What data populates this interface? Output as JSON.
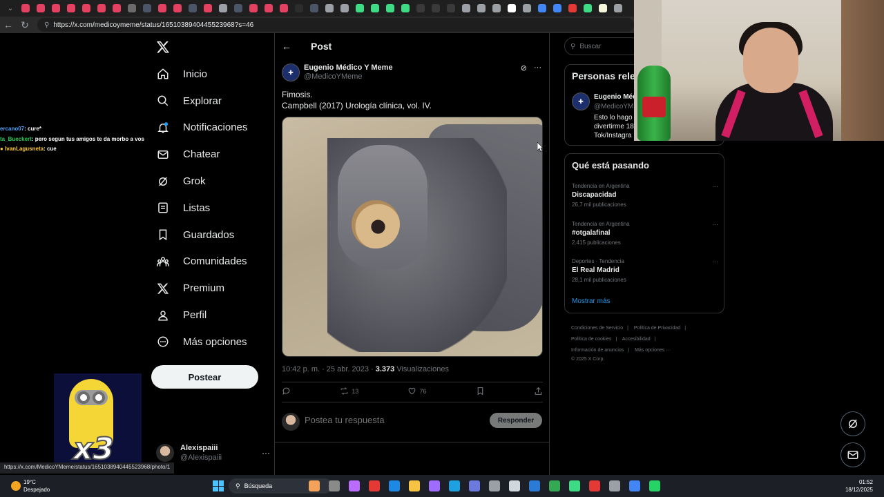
{
  "browser": {
    "url": "https://x.com/medicoymeme/status/1651038940445523968?s=46",
    "tab_colors": [
      "#e4405f",
      "#e4405f",
      "#e4405f",
      "#e4405f",
      "#e4405f",
      "#e4405f",
      "#e4405f",
      "#6b6b6b",
      "#4a5568",
      "#e4405f",
      "#e4405f",
      "#4a5568",
      "#e4405f",
      "#9aa0a6",
      "#4a5568",
      "#e4405f",
      "#e4405f",
      "#e4405f",
      "#2d2d2d",
      "#4a5568",
      "#9aa0a6",
      "#9aa0a6",
      "#3ddc84",
      "#3ddc84",
      "#3ddc84",
      "#3ddc84",
      "#3a3a3a",
      "#3a3a3a",
      "#3a3a3a",
      "#9aa0a6",
      "#9aa0a6",
      "#9aa0a6",
      "#ffffff",
      "#9aa0a6",
      "#4285f4",
      "#4285f4",
      "#e53935",
      "#3ddc84",
      "#f5f5dc",
      "#9aa0a6"
    ],
    "status_url": "https://x.com/MedicoYMeme/status/1651038940445523968/photo/1"
  },
  "nav": {
    "items": [
      {
        "label": "Inicio",
        "icon": "home-icon"
      },
      {
        "label": "Explorar",
        "icon": "search-icon"
      },
      {
        "label": "Notificaciones",
        "icon": "bell-icon"
      },
      {
        "label": "Chatear",
        "icon": "mail-icon"
      },
      {
        "label": "Grok",
        "icon": "grok-icon"
      },
      {
        "label": "Listas",
        "icon": "list-icon"
      },
      {
        "label": "Guardados",
        "icon": "bookmark-icon"
      },
      {
        "label": "Comunidades",
        "icon": "community-icon"
      },
      {
        "label": "Premium",
        "icon": "x-icon"
      },
      {
        "label": "Perfil",
        "icon": "user-icon"
      },
      {
        "label": "Más opciones",
        "icon": "more-circle-icon"
      }
    ],
    "post_button": "Postear",
    "account": {
      "name": "Alexispaiii",
      "handle": "@Alexispaiii"
    }
  },
  "chat": [
    {
      "user": "ercano07",
      "message": ": cure*"
    },
    {
      "user": "ta_Bueckert",
      "message": ": pero segun tus amigos te da morbo a vos"
    },
    {
      "user": "IvanLagusneta",
      "message": ": cue"
    }
  ],
  "sticker": {
    "text": "x3"
  },
  "post": {
    "header": "Post",
    "author_name": "Eugenio Médico Y Meme",
    "author_handle": "@MedicoYMeme",
    "text_line1": "Fimosis.",
    "text_line2": "Campbell (2017) Urología clínica, vol. IV.",
    "time": "10:42 p. m. · 25 abr. 2023 · ",
    "views_count": "3.373",
    "views_label": " Visualizaciones",
    "retweets": "13",
    "likes": "76",
    "reply_placeholder": "Postea tu respuesta",
    "reply_button": "Responder"
  },
  "sidebar": {
    "search_placeholder": "Buscar",
    "relevant_title": "Personas rele",
    "relevant_name": "Eugenio Méd",
    "relevant_handle": "@MedicoYM",
    "relevant_bio": "Esto lo hago divertirme 18 Tok/Instagra",
    "trends_title": "Qué está pasando",
    "trends": [
      {
        "meta": "Tendencia en Argentina",
        "name": "Discapacidad",
        "count": "26,7 mil publicaciones"
      },
      {
        "meta": "Tendencia en Argentina",
        "name": "#otgalafinal",
        "count": "2.415 publicaciones"
      },
      {
        "meta": "Deportes · Tendencia",
        "name": "El Real Madrid",
        "count": "28,1 mil publicaciones"
      }
    ],
    "show_more": "Mostrar más",
    "footer": [
      "Condiciones de Servicio",
      "|",
      "Política de Privacidad",
      "|",
      "Política de cookies",
      "|",
      "Accesibilidad",
      "|",
      "Información de anuncios",
      "|",
      "Más opciones ···",
      "© 2025 X Corp."
    ]
  },
  "taskbar": {
    "temperature": "19°C",
    "weather": "Despejado",
    "search": "Búsqueda",
    "time": "01:52",
    "date": "18/12/2025",
    "icon_colors": [
      "#f4a259",
      "#8a8a8a",
      "#b96cff",
      "#e53935",
      "#1e88e5",
      "#f6c343",
      "#a06cff",
      "#1fa0e0",
      "#6c7ae0",
      "#9aa0a6",
      "#cfd8dc",
      "#2b7bd6",
      "#34a853",
      "#3ddc84",
      "#e53935",
      "#9aa0a6",
      "#4285f4",
      "#25d366"
    ]
  }
}
